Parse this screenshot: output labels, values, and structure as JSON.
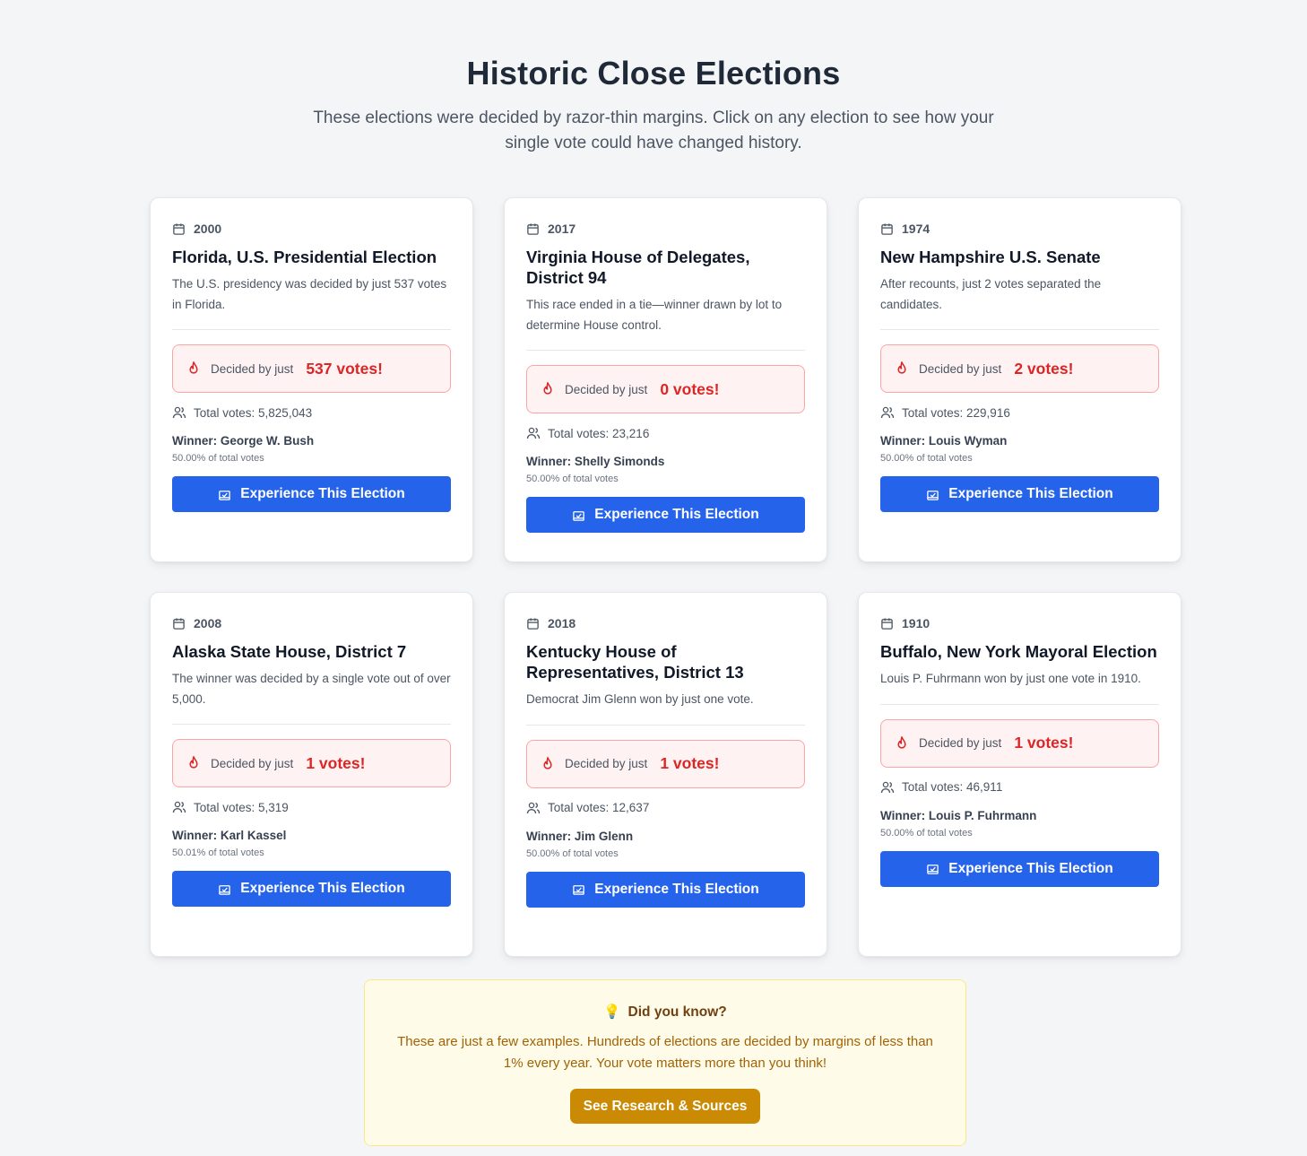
{
  "header": {
    "title": "Historic Close Elections",
    "subtitle": "These elections were decided by razor-thin margins. Click on any election to see how your single vote could have changed history."
  },
  "icons": {
    "calendar": "calendar-icon",
    "flame": "flame-icon",
    "users": "users-icon",
    "vote": "vote-icon",
    "lightbulb": "lightbulb-icon"
  },
  "colors": {
    "accent_blue": "#2563eb",
    "alert_red": "#dc2626",
    "alert_bg": "#fef2f2",
    "note_bg": "#fefce8",
    "note_button": "#ca8a04"
  },
  "elections": [
    {
      "year": "2000",
      "title": "Florida, U.S. Presidential Election",
      "description": "The U.S. presidency was decided by just 537 votes in Florida.",
      "margin_prefix": "Decided by just",
      "margin_votes": "537 votes!",
      "total_votes": "Total votes: 5,825,043",
      "winner": "Winner: George W. Bush",
      "winner_pct": "50.00% of total votes",
      "button_label": "Experience This Election"
    },
    {
      "year": "2017",
      "title": "Virginia House of Delegates, District 94",
      "description": "This race ended in a tie—winner drawn by lot to determine House control.",
      "margin_prefix": "Decided by just",
      "margin_votes": "0 votes!",
      "total_votes": "Total votes: 23,216",
      "winner": "Winner: Shelly Simonds",
      "winner_pct": "50.00% of total votes",
      "button_label": "Experience This Election"
    },
    {
      "year": "1974",
      "title": "New Hampshire U.S. Senate",
      "description": "After recounts, just 2 votes separated the candidates.",
      "margin_prefix": "Decided by just",
      "margin_votes": "2 votes!",
      "total_votes": "Total votes: 229,916",
      "winner": "Winner: Louis Wyman",
      "winner_pct": "50.00% of total votes",
      "button_label": "Experience This Election"
    },
    {
      "year": "2008",
      "title": "Alaska State House, District 7",
      "description": "The winner was decided by a single vote out of over 5,000.",
      "margin_prefix": "Decided by just",
      "margin_votes": "1 votes!",
      "total_votes": "Total votes: 5,319",
      "winner": "Winner: Karl Kassel",
      "winner_pct": "50.01% of total votes",
      "button_label": "Experience This Election"
    },
    {
      "year": "2018",
      "title": "Kentucky House of Representatives, District 13",
      "description": "Democrat Jim Glenn won by just one vote.",
      "margin_prefix": "Decided by just",
      "margin_votes": "1 votes!",
      "total_votes": "Total votes: 12,637",
      "winner": "Winner: Jim Glenn",
      "winner_pct": "50.00% of total votes",
      "button_label": "Experience This Election"
    },
    {
      "year": "1910",
      "title": "Buffalo, New York Mayoral Election",
      "description": "Louis P. Fuhrmann won by just one vote in 1910.",
      "margin_prefix": "Decided by just",
      "margin_votes": "1 votes!",
      "total_votes": "Total votes: 46,911",
      "winner": "Winner: Louis P. Fuhrmann",
      "winner_pct": "50.00% of total votes",
      "button_label": "Experience This Election"
    }
  ],
  "did_you_know": {
    "emoji": "💡",
    "heading": "Did you know?",
    "text": "These are just a few examples. Hundreds of elections are decided by margins of less than 1% every year. Your vote matters more than you think!",
    "button_label": "See Research & Sources"
  }
}
